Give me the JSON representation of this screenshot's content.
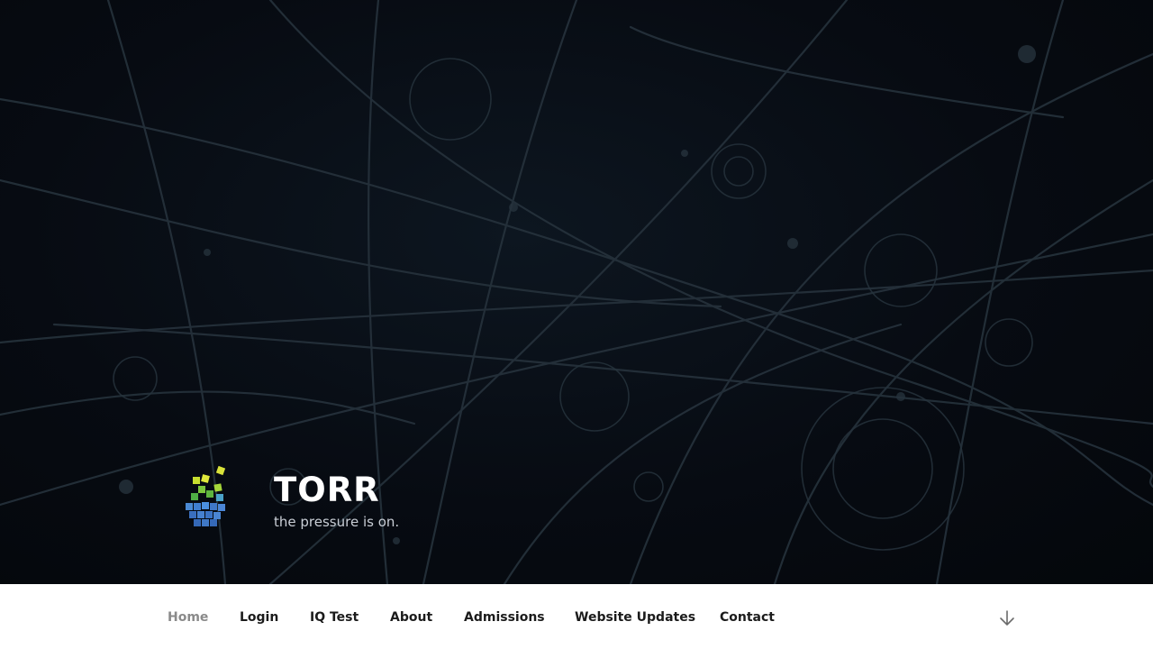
{
  "site": {
    "title": "TORR",
    "tagline": "the pressure is on."
  },
  "nav": {
    "items": [
      {
        "label": "Home",
        "current": true
      },
      {
        "label": "Login"
      },
      {
        "label": "IQ Test"
      },
      {
        "label": "About"
      },
      {
        "label": "Admissions"
      },
      {
        "label": "Website Updates"
      },
      {
        "label": "Contact"
      }
    ]
  },
  "icons": {
    "logo": "pressure-cubes-logo",
    "scroll": "arrow-down-icon"
  },
  "colors": {
    "hero_background": "#070b12",
    "track_lines": "#2a3640",
    "title": "#ffffff",
    "nav_text": "#1b1b1b",
    "nav_current": "#8a8a8a"
  }
}
